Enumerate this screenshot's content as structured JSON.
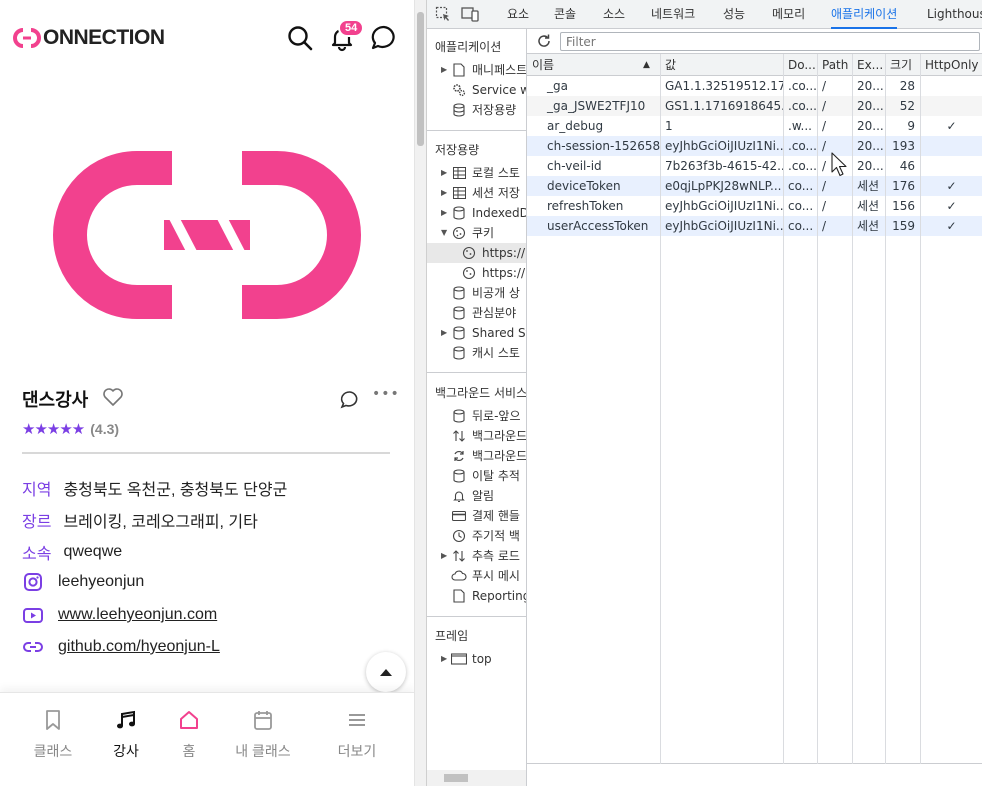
{
  "app": {
    "brand": "ONNECTION",
    "notification_count": "54",
    "name": "댄스강사",
    "stars": "★★★★★",
    "rating": "(4.3)",
    "region_label": "지역",
    "region_value": "충청북도 옥천군, 충청북도 단양군",
    "genre_label": "장르",
    "genre_value": "브레이킹, 코레오그래피, 기타",
    "affiliation_label": "소속",
    "affiliation_value": "qweqwe",
    "instagram": "leehyeonjun",
    "youtube": "www.leehyeonjun.com",
    "github": "github.com/hyeonjun-L",
    "nav": [
      {
        "label": "클래스",
        "icon": "bookmark-icon"
      },
      {
        "label": "강사",
        "icon": "music-note-icon"
      },
      {
        "label": "홈",
        "icon": "home-icon"
      },
      {
        "label": "내 클래스",
        "icon": "calendar-icon"
      },
      {
        "label": "더보기",
        "icon": "menu-icon"
      }
    ],
    "accent_color": "#7b3fe4",
    "brand_color": "#f2418e"
  },
  "devtools": {
    "tabs": [
      "요소",
      "콘솔",
      "소스",
      "네트워크",
      "성능",
      "메모리",
      "애플리케이션",
      "Lighthouse"
    ],
    "active_tab": "애플리케이션",
    "sidebar": {
      "app_section": "애플리케이션",
      "app_items": [
        "매니페스트",
        "Service w",
        "저장용량"
      ],
      "storage_section": "저장용량",
      "storage_items": [
        "로컬 스토",
        "세션 저장",
        "IndexedD",
        "쿠키",
        "https://",
        "https://",
        "비공개 상",
        "관심분야",
        "Shared St",
        "캐시 스토"
      ],
      "bg_section": "백그라운드 서비스",
      "bg_items": [
        "뒤로-앞으",
        "백그라운드",
        "백그라운드",
        "이탈 추적",
        "알림",
        "결제 핸들",
        "주기적 백",
        "추측 로드",
        "푸시 메시",
        "Reporting"
      ],
      "frames_section": "프레임",
      "frames_items": [
        "top"
      ]
    },
    "filter_placeholder": "Filter",
    "columns": [
      "이름",
      "값",
      "Do...",
      "Path",
      "Ex...",
      "크기",
      "HttpOnly"
    ],
    "rows": [
      {
        "name": "_ga",
        "value": "GA1.1.32519512.17...",
        "domain": ".co...",
        "path": "/",
        "expires": "20...",
        "size": "28",
        "httponly": ""
      },
      {
        "name": "_ga_JSWE2TFJ10",
        "value": "GS1.1.1716918645....",
        "domain": ".co...",
        "path": "/",
        "expires": "20...",
        "size": "52",
        "httponly": ""
      },
      {
        "name": "ar_debug",
        "value": "1",
        "domain": ".w...",
        "path": "/",
        "expires": "20...",
        "size": "9",
        "httponly": "✓"
      },
      {
        "name": "ch-session-152658",
        "value": "eyJhbGciOiJIUzI1Ni...",
        "domain": ".co...",
        "path": "/",
        "expires": "20...",
        "size": "193",
        "httponly": ""
      },
      {
        "name": "ch-veil-id",
        "value": "7b263f3b-4615-42...",
        "domain": ".co...",
        "path": "/",
        "expires": "20...",
        "size": "46",
        "httponly": ""
      },
      {
        "name": "deviceToken",
        "value": "e0qjLpPKJ28wNLP...",
        "domain": "co...",
        "path": "/",
        "expires": "세션",
        "size": "176",
        "httponly": "✓"
      },
      {
        "name": "refreshToken",
        "value": "eyJhbGciOiJIUzI1Ni...",
        "domain": "co...",
        "path": "/",
        "expires": "세션",
        "size": "156",
        "httponly": "✓"
      },
      {
        "name": "userAccessToken",
        "value": "eyJhbGciOiJIUzI1Ni...",
        "domain": "co...",
        "path": "/",
        "expires": "세션",
        "size": "159",
        "httponly": "✓"
      }
    ]
  }
}
